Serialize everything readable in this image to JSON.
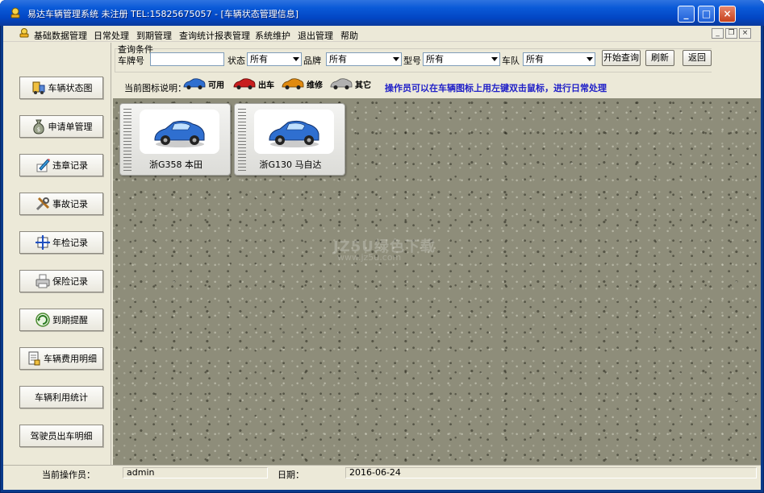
{
  "window": {
    "title": "易达车辆管理系统 未注册  TEL:15825675057 - [车辆状态管理信息]",
    "controls": {
      "minimize": "_",
      "maximize": "□",
      "close": "×"
    }
  },
  "menu": {
    "items": [
      "基础数据管理",
      "日常处理",
      "到期管理",
      "查询统计报表管理",
      "系统维护",
      "退出管理",
      "帮助"
    ],
    "mdi": {
      "minimize": "_",
      "restore": "❐",
      "close": "×"
    }
  },
  "sidebar": {
    "items": [
      {
        "label": "车辆状态图",
        "icon": "truck-icon"
      },
      {
        "label": "申请单管理",
        "icon": "money-bag-icon"
      },
      {
        "label": "违章记录",
        "icon": "pencil-icon"
      },
      {
        "label": "事故记录",
        "icon": "tools-icon"
      },
      {
        "label": "年检记录",
        "icon": "inspection-icon"
      },
      {
        "label": "保险记录",
        "icon": "printer-icon"
      },
      {
        "label": "到期提醒",
        "icon": "refresh-icon"
      },
      {
        "label": "车辆费用明细",
        "icon": "document-icon"
      },
      {
        "label": "车辆利用统计",
        "icon": ""
      },
      {
        "label": "驾驶员出车明细",
        "icon": ""
      }
    ]
  },
  "query": {
    "group_title": "查询条件",
    "plate_label": "车牌号",
    "plate_value": "",
    "status_label": "状态",
    "status_value": "所有",
    "brand_label": "品牌",
    "brand_value": "所有",
    "model_label": "型号",
    "model_value": "所有",
    "team_label": "车队",
    "team_value": "所有",
    "search_button": "开始查询",
    "refresh_button": "刷新",
    "back_button": "返回"
  },
  "legend": {
    "label": "当前图标说明：",
    "items": [
      {
        "label": "可用",
        "color": "#2f6fd0"
      },
      {
        "label": "出车",
        "color": "#c81e1e"
      },
      {
        "label": "维修",
        "color": "#e08a10"
      },
      {
        "label": "其它",
        "color": "#a8a8a8"
      }
    ]
  },
  "hint": "操作员可以在车辆图标上用左键双击鼠标，进行日常处理",
  "watermark": {
    "line1": "JZ5U绿色下载",
    "line2": "www.jz5u.com"
  },
  "vehicles": [
    {
      "plate": "浙G358  本田",
      "status_color": "#2f6fd0"
    },
    {
      "plate": "浙G130  马自达",
      "status_color": "#2f6fd0"
    }
  ],
  "status": {
    "operator_label": "当前操作员：",
    "operator_value": "admin",
    "date_label": "日期：",
    "date_value": "2016-06-24"
  }
}
